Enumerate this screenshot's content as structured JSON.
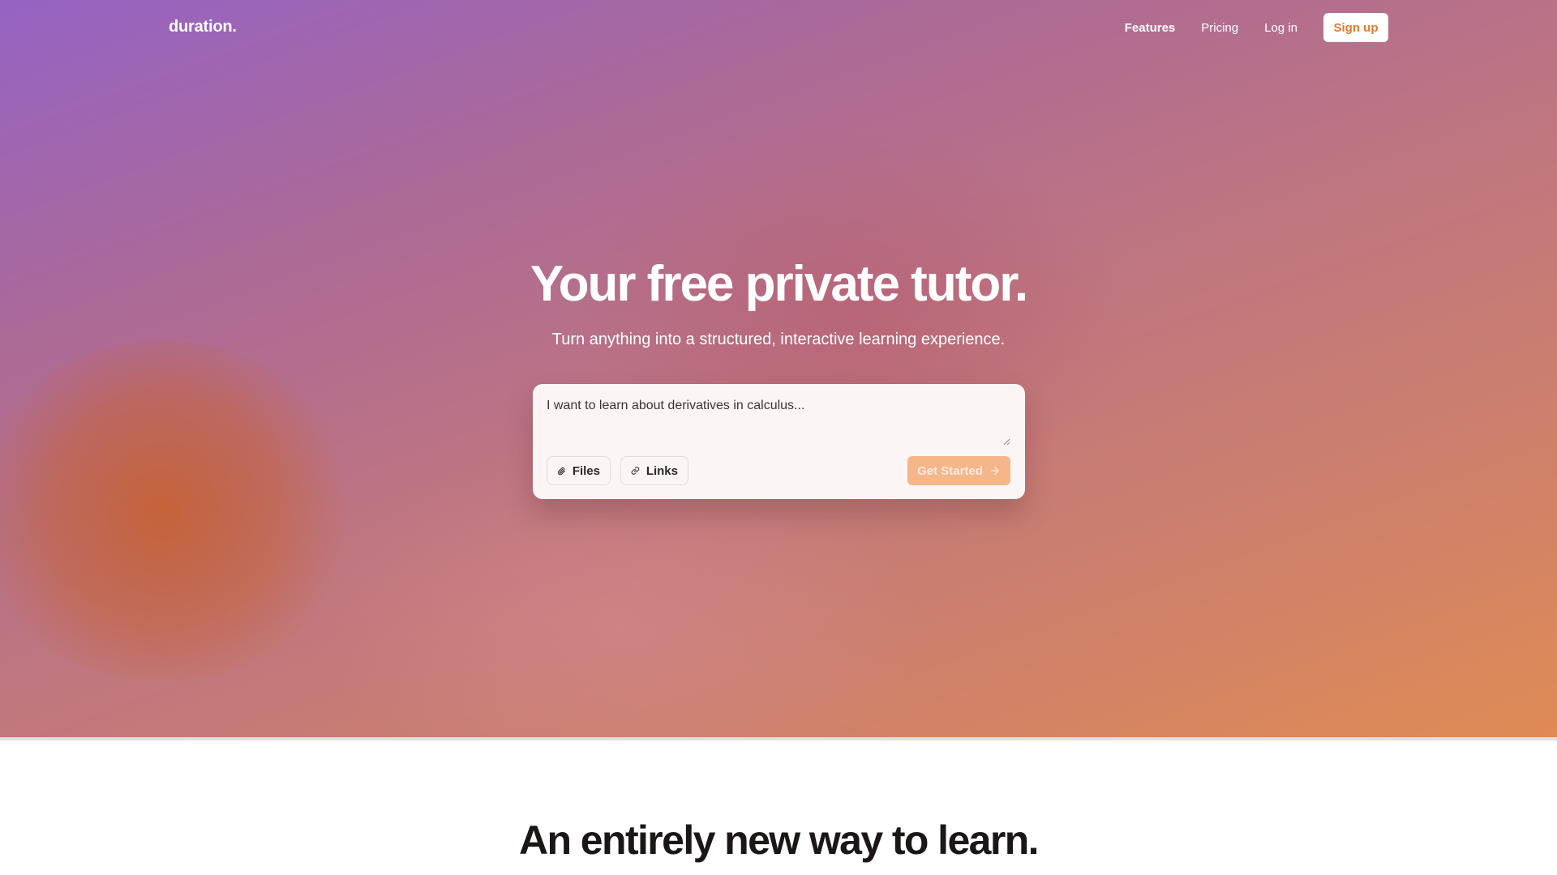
{
  "brand": {
    "logo_text": "duration."
  },
  "nav": {
    "features": "Features",
    "pricing": "Pricing",
    "login": "Log in",
    "signup": "Sign up"
  },
  "hero": {
    "headline": "Your free private tutor.",
    "subhead": "Turn anything into a structured, interactive learning experience.",
    "input_value": "I want to learn about derivatives in calculus...",
    "files_label": "Files",
    "links_label": "Links",
    "cta_label": "Get Started"
  },
  "section": {
    "title": "An entirely new way to learn."
  },
  "colors": {
    "accent": "#e07a2e",
    "cta_bg": "#f5b68a",
    "hero_start": "#9563c4",
    "hero_end": "#e08b55"
  },
  "icons": {
    "files": "paperclip-icon",
    "links": "link-icon",
    "cta": "arrow-right-icon"
  }
}
